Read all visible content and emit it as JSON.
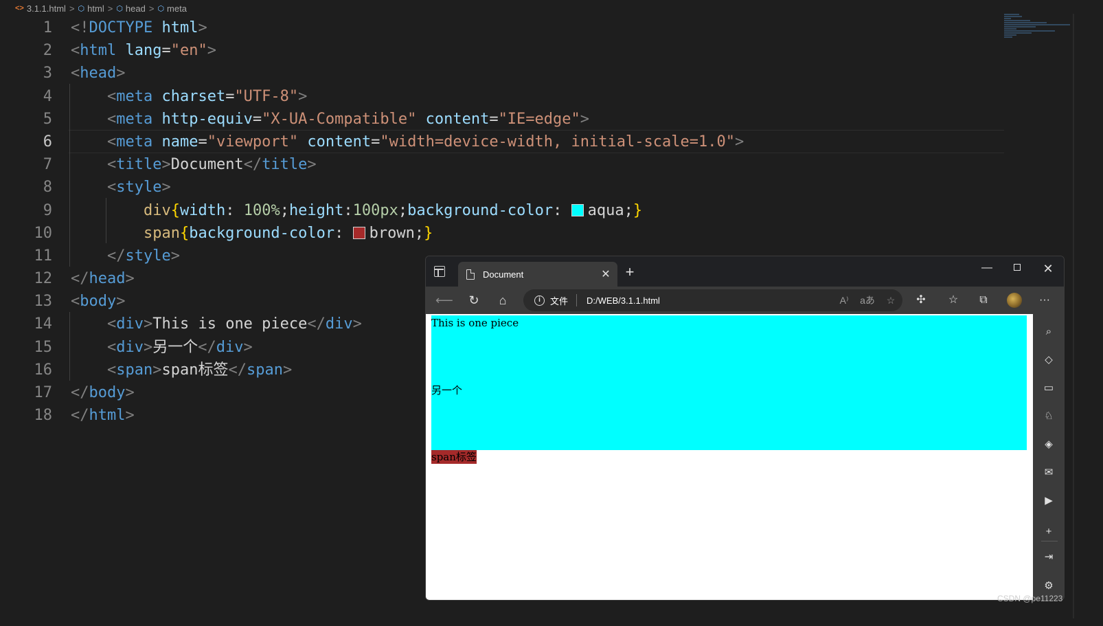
{
  "breadcrumb": {
    "items": [
      "3.1.1.html",
      "html",
      "head",
      "meta"
    ],
    "separator": ">"
  },
  "editor": {
    "active_line": 6,
    "line_numbers": [
      "1",
      "2",
      "3",
      "4",
      "5",
      "6",
      "7",
      "8",
      "9",
      "10",
      "11",
      "12",
      "13",
      "14",
      "15",
      "16",
      "17",
      "18"
    ],
    "lines": [
      [
        [
          "p",
          "<!"
        ],
        [
          "t",
          "DOCTYPE"
        ],
        [
          "x",
          " "
        ],
        [
          "a",
          "html"
        ],
        [
          "p",
          ">"
        ]
      ],
      [
        [
          "p",
          "<"
        ],
        [
          "t",
          "html"
        ],
        [
          "x",
          " "
        ],
        [
          "a",
          "lang"
        ],
        [
          "x",
          "="
        ],
        [
          "s",
          "\"en\""
        ],
        [
          "p",
          ">"
        ]
      ],
      [
        [
          "p",
          "<"
        ],
        [
          "t",
          "head"
        ],
        [
          "p",
          ">"
        ]
      ],
      [
        [
          "x",
          "    "
        ],
        [
          "p",
          "<"
        ],
        [
          "t",
          "meta"
        ],
        [
          "x",
          " "
        ],
        [
          "a",
          "charset"
        ],
        [
          "x",
          "="
        ],
        [
          "s",
          "\"UTF-8\""
        ],
        [
          "p",
          ">"
        ]
      ],
      [
        [
          "x",
          "    "
        ],
        [
          "p",
          "<"
        ],
        [
          "t",
          "meta"
        ],
        [
          "x",
          " "
        ],
        [
          "a",
          "http-equiv"
        ],
        [
          "x",
          "="
        ],
        [
          "s",
          "\"X-UA-Compatible\""
        ],
        [
          "x",
          " "
        ],
        [
          "a",
          "content"
        ],
        [
          "x",
          "="
        ],
        [
          "s",
          "\"IE=edge\""
        ],
        [
          "p",
          ">"
        ]
      ],
      [
        [
          "x",
          "    "
        ],
        [
          "p",
          "<"
        ],
        [
          "t",
          "meta"
        ],
        [
          "x",
          " "
        ],
        [
          "a",
          "name"
        ],
        [
          "x",
          "="
        ],
        [
          "s",
          "\"viewport\""
        ],
        [
          "x",
          " "
        ],
        [
          "a",
          "content"
        ],
        [
          "x",
          "="
        ],
        [
          "s",
          "\"width=device-width, initial-scale=1.0\""
        ],
        [
          "p",
          ">"
        ]
      ],
      [
        [
          "x",
          "    "
        ],
        [
          "p",
          "<"
        ],
        [
          "t",
          "title"
        ],
        [
          "p",
          ">"
        ],
        [
          "x",
          "Document"
        ],
        [
          "p",
          "</"
        ],
        [
          "t",
          "title"
        ],
        [
          "p",
          ">"
        ]
      ],
      [
        [
          "x",
          "    "
        ],
        [
          "p",
          "<"
        ],
        [
          "t",
          "style"
        ],
        [
          "p",
          ">"
        ]
      ],
      [
        [
          "x",
          "        "
        ],
        [
          "sel",
          "div"
        ],
        [
          "b",
          "{"
        ],
        [
          "pr",
          "width"
        ],
        [
          "x",
          ": "
        ],
        [
          "n",
          "100%"
        ],
        [
          "x",
          ";"
        ],
        [
          "pr",
          "height"
        ],
        [
          "x",
          ":"
        ],
        [
          "n",
          "100px"
        ],
        [
          "x",
          ";"
        ],
        [
          "pr",
          "background-color"
        ],
        [
          "x",
          ": "
        ],
        [
          "sw",
          "#00ffff"
        ],
        [
          "v",
          "aqua"
        ],
        [
          "x",
          ";"
        ],
        [
          "b",
          "}"
        ]
      ],
      [
        [
          "x",
          "        "
        ],
        [
          "sel",
          "span"
        ],
        [
          "b",
          "{"
        ],
        [
          "pr",
          "background-color"
        ],
        [
          "x",
          ": "
        ],
        [
          "sw",
          "#a52a2a"
        ],
        [
          "v",
          "brown"
        ],
        [
          "x",
          ";"
        ],
        [
          "b",
          "}"
        ]
      ],
      [
        [
          "x",
          "    "
        ],
        [
          "p",
          "</"
        ],
        [
          "t",
          "style"
        ],
        [
          "p",
          ">"
        ]
      ],
      [
        [
          "p",
          "</"
        ],
        [
          "t",
          "head"
        ],
        [
          "p",
          ">"
        ]
      ],
      [
        [
          "p",
          "<"
        ],
        [
          "t",
          "body"
        ],
        [
          "p",
          ">"
        ]
      ],
      [
        [
          "x",
          "    "
        ],
        [
          "p",
          "<"
        ],
        [
          "t",
          "div"
        ],
        [
          "p",
          ">"
        ],
        [
          "x",
          "This is one piece"
        ],
        [
          "p",
          "</"
        ],
        [
          "t",
          "div"
        ],
        [
          "p",
          ">"
        ]
      ],
      [
        [
          "x",
          "    "
        ],
        [
          "p",
          "<"
        ],
        [
          "t",
          "div"
        ],
        [
          "p",
          ">"
        ],
        [
          "x",
          "另一个"
        ],
        [
          "p",
          "</"
        ],
        [
          "t",
          "div"
        ],
        [
          "p",
          ">"
        ]
      ],
      [
        [
          "x",
          "    "
        ],
        [
          "p",
          "<"
        ],
        [
          "t",
          "span"
        ],
        [
          "p",
          ">"
        ],
        [
          "x",
          "span标签"
        ],
        [
          "p",
          "</"
        ],
        [
          "t",
          "span"
        ],
        [
          "p",
          ">"
        ]
      ],
      [
        [
          "p",
          "</"
        ],
        [
          "t",
          "body"
        ],
        [
          "p",
          ">"
        ]
      ],
      [
        [
          "p",
          "</"
        ],
        [
          "t",
          "html"
        ],
        [
          "p",
          ">"
        ]
      ]
    ]
  },
  "browser": {
    "tab_title": "Document",
    "new_tab_glyph": "+",
    "close_tab_glyph": "✕",
    "window_minimize": "—",
    "window_close": "✕",
    "address_file_label": "文件",
    "address_url": "D:/WEB/3.1.1.html",
    "page": {
      "div1_text": "This is one piece",
      "div2_text": "另一个",
      "span_text": "span标签",
      "div_color": "#00ffff",
      "span_color": "#a52a2a"
    },
    "toolbar_icons": [
      "back-icon",
      "reload-icon",
      "home-icon",
      "read-aloud-icon",
      "translate-icon",
      "add-favorite-icon",
      "extensions-icon",
      "favorites-icon",
      "collections-icon",
      "profile-avatar",
      "more-icon"
    ],
    "sidebar_icons": [
      "search-icon",
      "shopping-tag-icon",
      "tools-icon",
      "games-icon",
      "office-icon",
      "outlook-icon",
      "youtube-icon",
      "add-icon",
      "split-screen-icon",
      "settings-icon"
    ]
  },
  "watermark": "CSDN @pe11223",
  "colors": {
    "editor_bg": "#1e1e1e",
    "tag": "#569cd6",
    "attribute": "#9cdcfe",
    "string": "#ce9178",
    "selector": "#d7ba7d",
    "brace": "#ffd700",
    "number": "#b5cea8"
  }
}
